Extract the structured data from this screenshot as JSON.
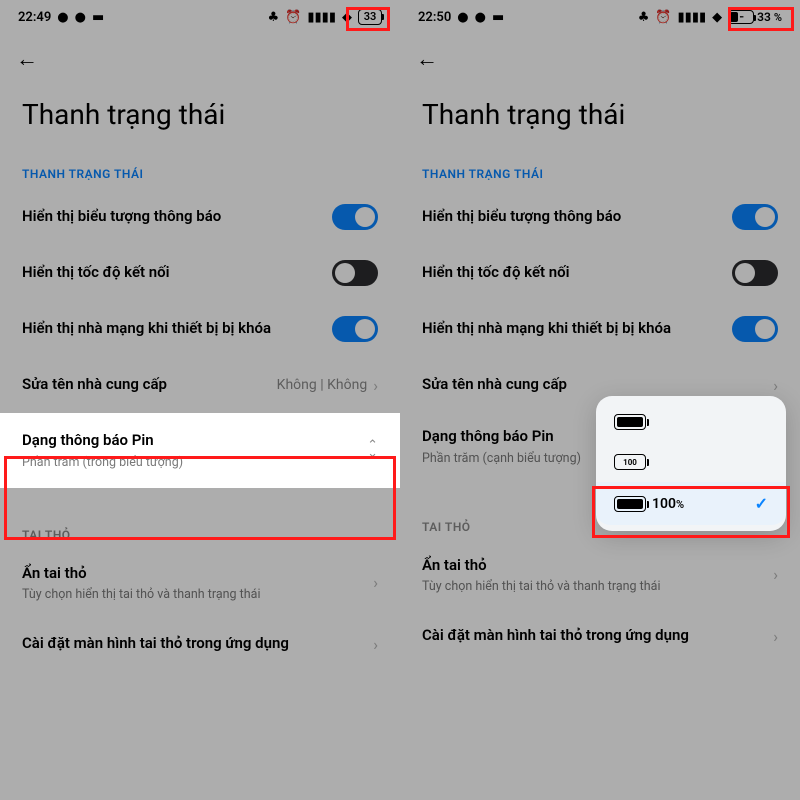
{
  "left": {
    "status": {
      "time": "22:49",
      "battery_text": "33"
    },
    "page_title": "Thanh trạng thái",
    "section_status": "THANH TRẠNG THÁI",
    "row_notif_icons": "Hiển thị biểu tượng thông báo",
    "row_speed": "Hiển thị tốc độ kết nối",
    "row_carrier_lock": "Hiển thị nhà mạng khi thiết bị bị khóa",
    "row_edit_carrier": {
      "title": "Sửa tên nhà cung cấp",
      "value": "Không | Không"
    },
    "row_battery_style": {
      "title": "Dạng thông báo Pin",
      "sub": "Phần trăm (trong biểu tượng)"
    },
    "section_notch": "TAI THỎ",
    "row_hide_notch": {
      "title": "Ẩn tai thỏ",
      "sub": "Tùy chọn hiển thị tai thỏ và thanh trạng thái"
    },
    "row_notch_apps": "Cài đặt màn hình tai thỏ trong ứng dụng"
  },
  "right": {
    "status": {
      "time": "22:50",
      "battery_text": "33",
      "battery_pct_suffix": "%"
    },
    "page_title": "Thanh trạng thái",
    "section_status": "THANH TRẠNG THÁI",
    "row_notif_icons": "Hiển thị biểu tượng thông báo",
    "row_speed": "Hiển thị tốc độ kết nối",
    "row_carrier_lock": "Hiển thị nhà mạng khi thiết bị bị khóa",
    "row_edit_carrier": {
      "title": "Sửa tên nhà cung cấp"
    },
    "row_battery_style": {
      "title": "Dạng thông báo Pin",
      "sub": "Phần trăm (cạnh biểu tượng)"
    },
    "popup": {
      "opt_num_in_icon": "100",
      "opt_combo_label": "100",
      "opt_combo_suffix": "%"
    },
    "section_notch": "TAI THỎ",
    "row_hide_notch": {
      "title": "Ẩn tai thỏ",
      "sub": "Tùy chọn hiển thị tai thỏ và thanh trạng thái"
    },
    "row_notch_apps": "Cài đặt màn hình tai thỏ trong ứng dụng"
  }
}
